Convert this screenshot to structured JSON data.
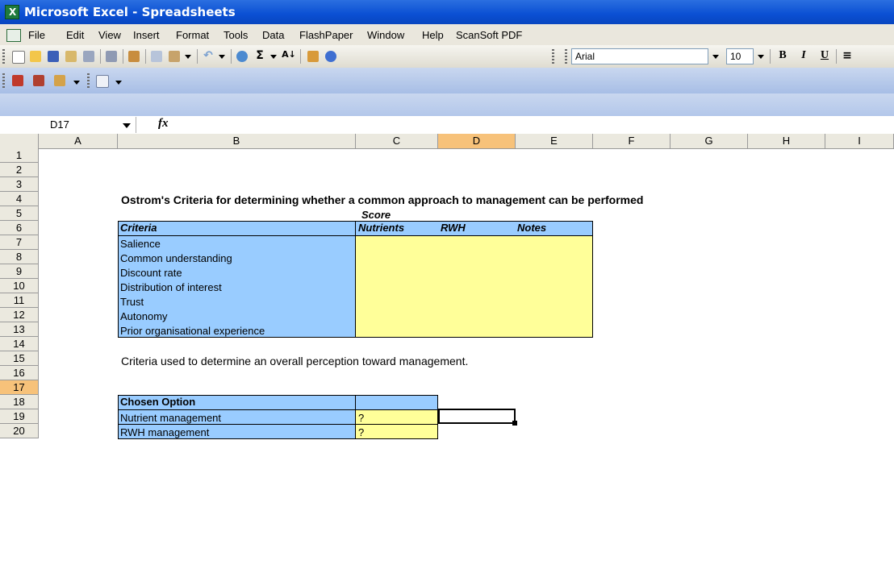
{
  "window": {
    "title": "Microsoft Excel - Spreadsheets"
  },
  "menu": [
    "File",
    "Edit",
    "View",
    "Insert",
    "Format",
    "Tools",
    "Data",
    "FlashPaper",
    "Window",
    "Help",
    "ScanSoft PDF"
  ],
  "toolbar": {
    "font_name": "Arial",
    "font_size": "10",
    "bold": "B",
    "italic": "I",
    "underline": "U"
  },
  "formula_bar": {
    "name_box": "D17",
    "fx": "fx",
    "formula": ""
  },
  "columns": [
    "A",
    "B",
    "C",
    "D",
    "E",
    "F",
    "G",
    "H",
    "I"
  ],
  "rows": [
    "1",
    "2",
    "3",
    "4",
    "5",
    "6",
    "7",
    "8",
    "9",
    "10",
    "11",
    "12",
    "13",
    "14",
    "15",
    "16",
    "17",
    "18",
    "19",
    "20"
  ],
  "sheet": {
    "heading": "Ostrom's Criteria for determining whether a common approach to management can be performed",
    "score_label": "Score",
    "table1_headers": {
      "criteria": "Criteria",
      "nutrients": "Nutrients",
      "rwh": "RWH",
      "notes": "Notes"
    },
    "criteria": [
      "Salience",
      "Common understanding",
      "Discount rate",
      "Distribution of interest",
      "Trust",
      "Autonomy",
      "Prior organisational experience"
    ],
    "note": "Criteria used to determine an overall perception toward management.",
    "table2_header": "Chosen Option",
    "options": [
      {
        "label": "Nutrient management",
        "value": "?"
      },
      {
        "label": "RWH management",
        "value": "?"
      }
    ]
  },
  "colors": {
    "header_blue": "#99ccff",
    "cell_yellow": "#ffff99",
    "selected_header": "#f7c27a",
    "titlebar": "#0a4fd3"
  }
}
